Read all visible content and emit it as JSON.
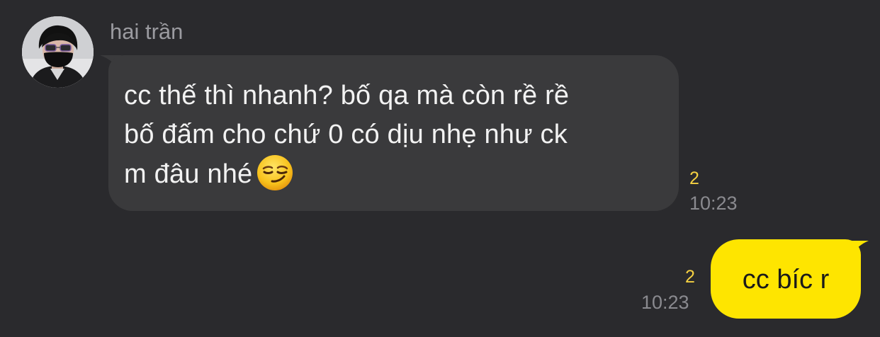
{
  "conversation": {
    "incoming": {
      "sender_name": "hai trần",
      "avatar_icon": "user-avatar-photo",
      "lines": [
        "cc thế thì nhanh? bố qa mà còn rề rề",
        "bố đấm cho chứ 0 có dịu nhẹ như ck",
        "m đâu nhé"
      ],
      "emoji_icon": "smirking-face-emoji",
      "unread_count": "2",
      "time": "10:23",
      "bubble_color": "#3a3a3c",
      "text_color": "#f2f2f2"
    },
    "outgoing": {
      "text": "cc bíc r",
      "unread_count": "2",
      "time": "10:23",
      "bubble_color": "#fee500",
      "text_color": "#1a1a1a"
    }
  },
  "theme": {
    "background": "#2a2a2d",
    "unread_color": "#f5d142",
    "time_color": "#8a8a8f",
    "name_color": "#9b9ba0"
  }
}
